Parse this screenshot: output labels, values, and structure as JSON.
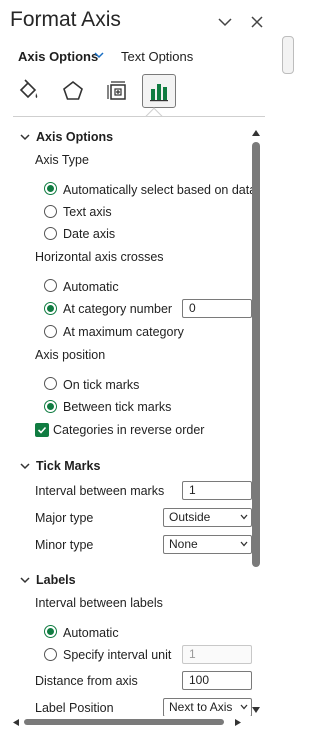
{
  "pane": {
    "title": "Format Axis",
    "tabs": {
      "axis_options": "Axis Options",
      "text_options": "Text Options"
    }
  },
  "icons": [
    "paint-bucket-icon",
    "pentagon-icon",
    "size-properties-icon",
    "bar-chart-icon"
  ],
  "accent_color": "#107c41",
  "axis_options": {
    "heading": "Axis Options",
    "axis_type": {
      "label": "Axis Type",
      "options": [
        "Automatically select based on data",
        "Text axis",
        "Date axis"
      ],
      "selected": "Automatically select based on data"
    },
    "crosses": {
      "label": "Horizontal axis crosses",
      "options": [
        "Automatic",
        "At category number",
        "At maximum category"
      ],
      "selected": "At category number",
      "category_number": "0"
    },
    "position": {
      "label": "Axis position",
      "options": [
        "On tick marks",
        "Between tick marks"
      ],
      "selected": "Between tick marks"
    },
    "reverse_label": "Categories in reverse order",
    "reverse_checked": true
  },
  "tick_marks": {
    "heading": "Tick Marks",
    "interval_label": "Interval between marks",
    "interval_value": "1",
    "major_label": "Major type",
    "major_value": "Outside",
    "minor_label": "Minor type",
    "minor_value": "None"
  },
  "labels": {
    "heading": "Labels",
    "interval_label": "Interval between labels",
    "options": [
      "Automatic",
      "Specify interval unit"
    ],
    "selected": "Automatic",
    "unit_value": "1",
    "distance_label": "Distance from axis",
    "distance_value": "100",
    "position_label": "Label Position",
    "position_value": "Next to Axis"
  }
}
